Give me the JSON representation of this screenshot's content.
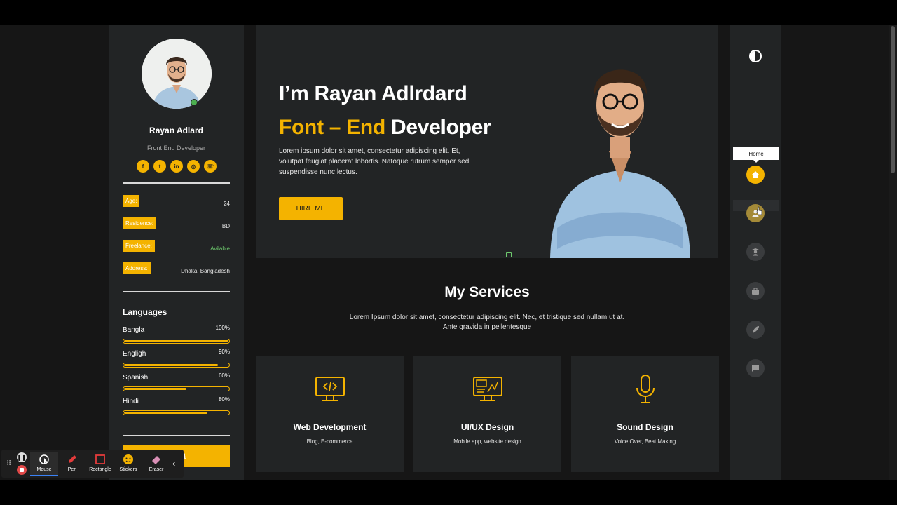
{
  "profile": {
    "name": "Rayan Adlard",
    "role": "Front End Developer",
    "socials": [
      {
        "icon": "facebook-icon",
        "glyph": "f"
      },
      {
        "icon": "twitter-icon",
        "glyph": "t"
      },
      {
        "icon": "linkedin-icon",
        "glyph": "in"
      },
      {
        "icon": "dribbble-icon",
        "glyph": "◎"
      },
      {
        "icon": "whatsapp-icon",
        "glyph": "☏"
      }
    ],
    "info": [
      {
        "key": "Age:",
        "value": "24"
      },
      {
        "key": "Residence:",
        "value": "BD"
      },
      {
        "key": "Freelance:",
        "value": "Avilable"
      },
      {
        "key": "Address:",
        "value": "Dhaka, Bangladesh"
      }
    ],
    "languages_title": "Languages",
    "languages": [
      {
        "name": "Bangla",
        "pct": "100%",
        "level": 1.0
      },
      {
        "name": "Engligh",
        "pct": "90%",
        "level": 0.9
      },
      {
        "name": "Spanish",
        "pct": "60%",
        "level": 0.6
      },
      {
        "name": "Hindi",
        "pct": "80%",
        "level": 0.8
      }
    ],
    "cv_button": "D CV ⤓"
  },
  "hero": {
    "line1": "I’m Rayan Adlrdard",
    "line2_accent": "Font – End",
    "line2_rest": " Developer",
    "description": "Lorem ipsum dolor sit amet, consectetur adipiscing elit. Et, volutpat feugiat placerat lobortis. Natoque rutrum semper sed suspendisse nunc lectus.",
    "button": "HIRE ME"
  },
  "services": {
    "title": "My Services",
    "description": "Lorem Ipsum dolor sit amet, consectetur adipiscing elit. Nec, et tristique sed nullam ut at. Ante gravida in pellentesque",
    "cards": [
      {
        "icon": "code-monitor-icon",
        "title": "Web Development",
        "subtitle": "Blog, E-commerce"
      },
      {
        "icon": "design-monitor-icon",
        "title": "UI/UX Design",
        "subtitle": "Mobile app, website design"
      },
      {
        "icon": "microphone-icon",
        "title": "Sound Design",
        "subtitle": "Voice Over, Beat Making"
      }
    ]
  },
  "right_nav": {
    "tooltip": "Home",
    "items": [
      {
        "icon": "home-icon",
        "state": "active"
      },
      {
        "icon": "user-icon",
        "state": "hover"
      },
      {
        "icon": "graduate-icon",
        "state": "normal"
      },
      {
        "icon": "briefcase-icon",
        "state": "normal"
      },
      {
        "icon": "feather-icon",
        "state": "normal"
      },
      {
        "icon": "chat-icon",
        "state": "normal"
      }
    ]
  },
  "recorder": {
    "tools": [
      {
        "label": "Mouse",
        "icon": "mouse-cursor-icon",
        "selected": true
      },
      {
        "label": "Pen",
        "icon": "pen-icon",
        "selected": false
      },
      {
        "label": "Rectangle",
        "icon": "rectangle-icon",
        "selected": false
      },
      {
        "label": "Stickers",
        "icon": "sticker-icon",
        "selected": false
      },
      {
        "label": "Eraser",
        "icon": "eraser-icon",
        "selected": false
      }
    ],
    "pause_glyph": "❚❚",
    "collapse_glyph": "‹"
  },
  "colors": {
    "accent": "#f4b300",
    "panel": "#222425",
    "background": "#161616"
  }
}
